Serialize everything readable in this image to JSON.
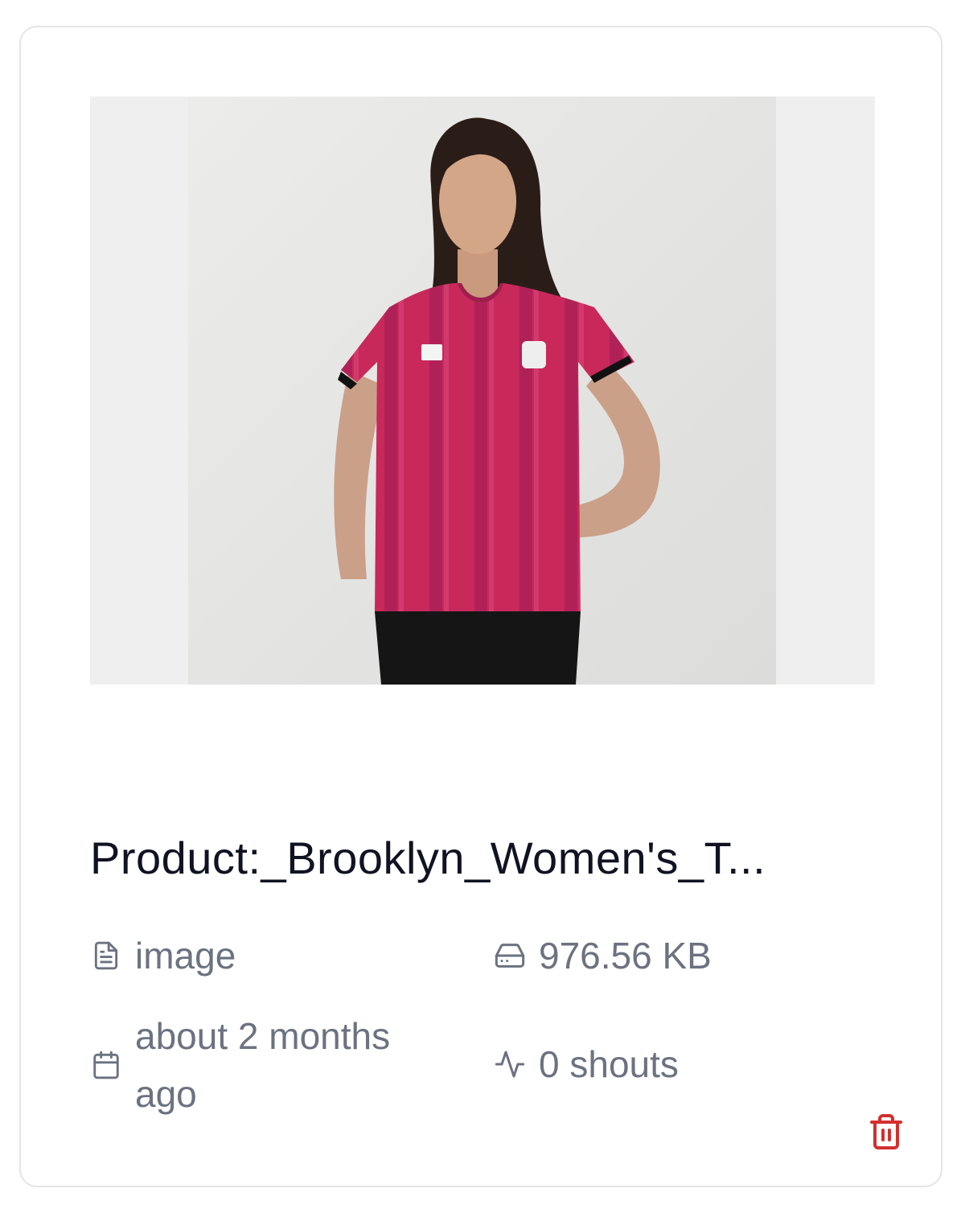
{
  "file": {
    "title": "Product:_Brooklyn_Women's_T...",
    "type": "image",
    "size": "976.56 KB",
    "uploaded": "about 2 months ago",
    "shouts": "0 shouts"
  },
  "icons": {
    "type": "file-text-icon",
    "size": "hard-drive-icon",
    "date": "calendar-icon",
    "shouts": "activity-icon",
    "delete": "trash-icon"
  },
  "colors": {
    "border": "#e3e5ea",
    "title": "#0f1322",
    "meta": "#6b7280",
    "delete": "#d32f2f",
    "shirt": "#c8285a"
  }
}
